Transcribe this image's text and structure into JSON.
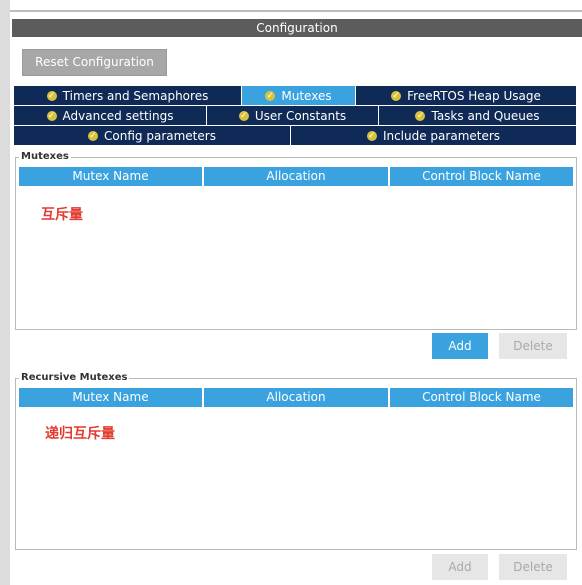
{
  "window": {
    "title": "Configuration"
  },
  "toolbar": {
    "reset_label": "Reset Configuration"
  },
  "tabs": [
    {
      "label": "Timers and Semaphores",
      "active": false
    },
    {
      "label": "Mutexes",
      "active": true
    },
    {
      "label": "FreeRTOS Heap Usage",
      "active": false
    },
    {
      "label": "Advanced settings",
      "active": false
    },
    {
      "label": "User Constants",
      "active": false
    },
    {
      "label": "Tasks and Queues",
      "active": false
    },
    {
      "label": "Config parameters",
      "active": false
    },
    {
      "label": "Include parameters",
      "active": false
    }
  ],
  "mutexes": {
    "title": "Mutexes",
    "columns": [
      "Mutex Name",
      "Allocation",
      "Control Block Name"
    ],
    "annotation": "互斥量",
    "add_label": "Add",
    "delete_label": "Delete"
  },
  "recursive_mutexes": {
    "title": "Recursive Mutexes",
    "columns": [
      "Mutex Name",
      "Allocation",
      "Control Block Name"
    ],
    "annotation": "递归互斥量",
    "add_label": "Add",
    "delete_label": "Delete"
  },
  "colors": {
    "tab_bg": "#0f2a57",
    "tab_active_bg": "#3aa3df",
    "header_bg": "#3aa3df",
    "annotation": "#e23b2f",
    "title_bar": "#5c5c5c"
  },
  "icons": {
    "tab_status": "check-circle-icon"
  }
}
